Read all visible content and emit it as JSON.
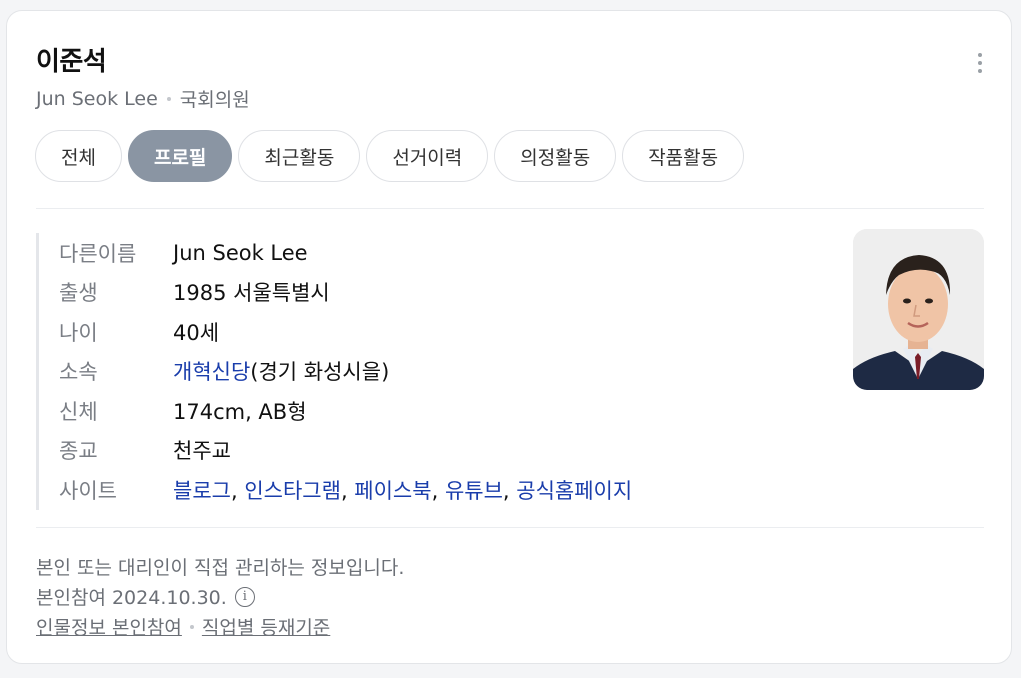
{
  "header": {
    "name": "이준석",
    "english_name": "Jun Seok Lee",
    "position": "국회의원"
  },
  "tabs": [
    {
      "label": "전체",
      "active": false
    },
    {
      "label": "프로필",
      "active": true
    },
    {
      "label": "최근활동",
      "active": false
    },
    {
      "label": "선거이력",
      "active": false
    },
    {
      "label": "의정활동",
      "active": false
    },
    {
      "label": "작품활동",
      "active": false
    }
  ],
  "profile": {
    "other_name": {
      "label": "다른이름",
      "value": "Jun Seok Lee"
    },
    "birth": {
      "label": "출생",
      "value": "1985 서울특별시"
    },
    "age": {
      "label": "나이",
      "value": "40세"
    },
    "affiliation": {
      "label": "소속",
      "party": "개혁신당",
      "district": "(경기 화성시을)"
    },
    "body": {
      "label": "신체",
      "value": "174cm, AB형"
    },
    "religion": {
      "label": "종교",
      "value": "천주교"
    },
    "sites": {
      "label": "사이트",
      "links": [
        "블로그",
        "인스타그램",
        "페이스북",
        "유튜브",
        "공식홈페이지"
      ],
      "separator": ", "
    }
  },
  "footer": {
    "notice": "본인 또는 대리인이 직접 관리하는 정보입니다.",
    "participation": "본인참여 2024.10.30.",
    "link_person": "인물정보 본인참여",
    "link_criteria": "직업별 등재기준"
  },
  "colors": {
    "link": "#1a3dab",
    "active_tab": "#8a95a3",
    "muted_text": "#6b6f76"
  },
  "icons": {
    "more": "more-vertical-icon",
    "info": "info-circle-icon"
  }
}
